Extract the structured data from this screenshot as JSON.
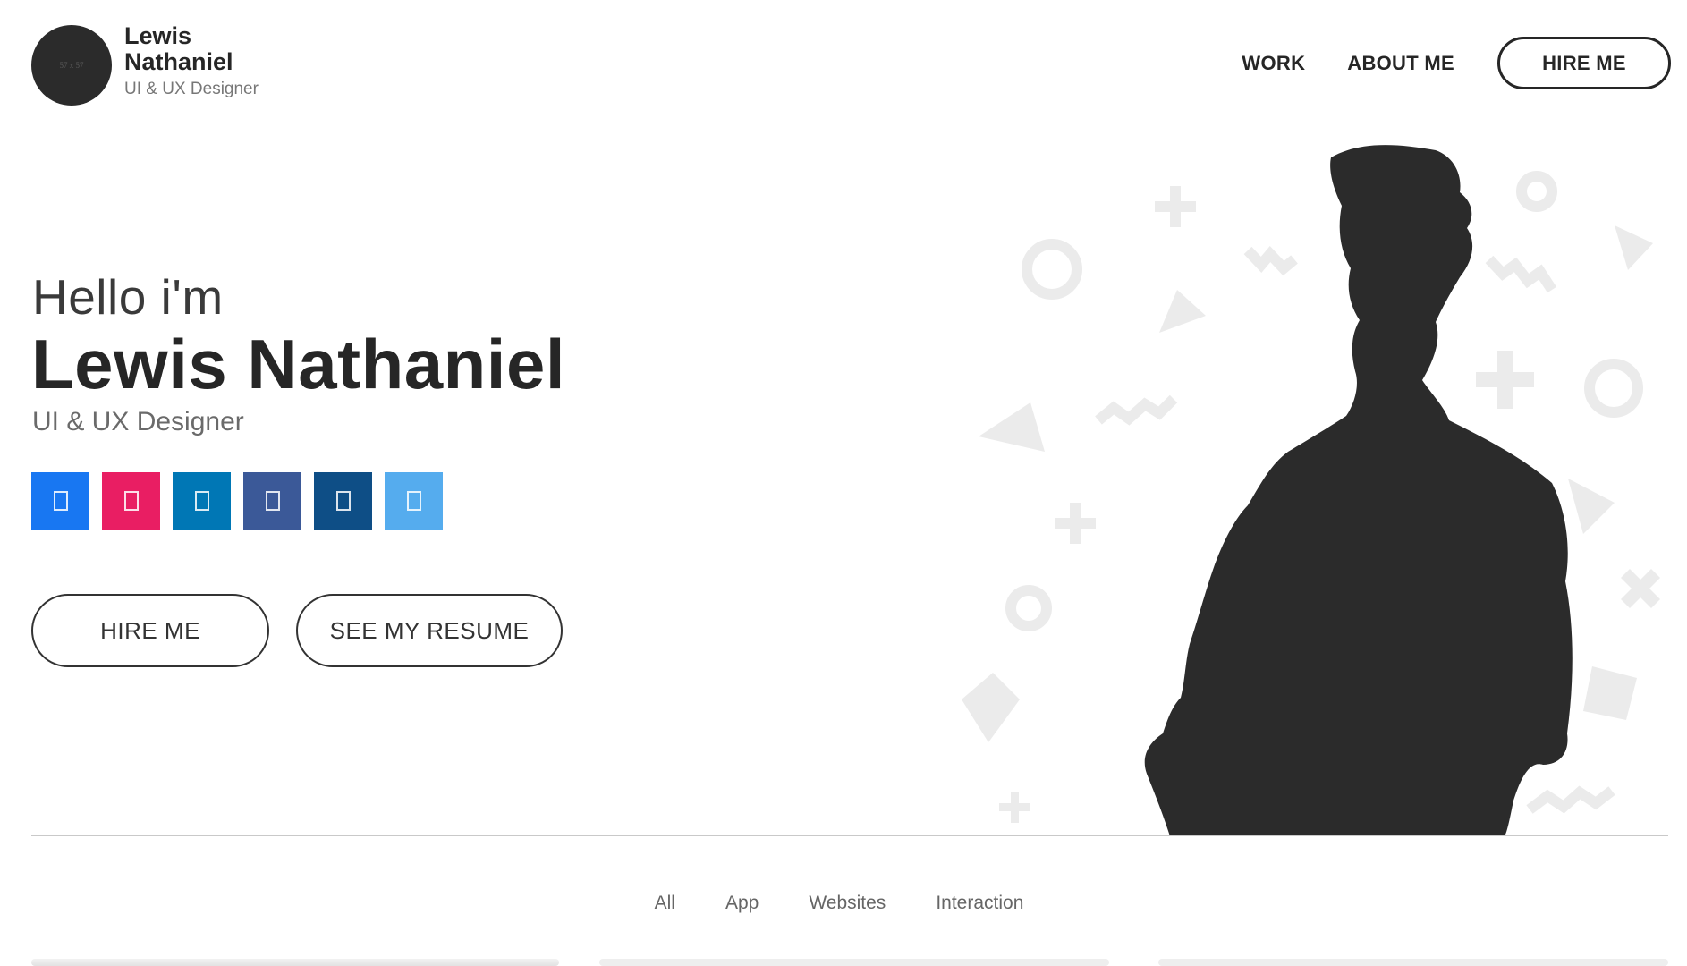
{
  "header": {
    "avatar_placeholder": "57 x 57",
    "brand_name": "Lewis Nathaniel",
    "brand_role": "UI & UX Designer",
    "nav": [
      {
        "label": "WORK"
      },
      {
        "label": "ABOUT ME"
      }
    ],
    "hire_label": "HIRE ME"
  },
  "hero": {
    "greeting": "Hello i'm",
    "name": "Lewis Nathaniel",
    "role": "UI & UX Designer",
    "socials": [
      {
        "icon": "facebook-icon",
        "color": "#1877f2"
      },
      {
        "icon": "instagram-icon",
        "color": "#e91e63"
      },
      {
        "icon": "linkedin-icon",
        "color": "#0077b5"
      },
      {
        "icon": "facebook-alt-icon",
        "color": "#3b5998"
      },
      {
        "icon": "linkedin-alt-icon",
        "color": "#0e4e86"
      },
      {
        "icon": "twitter-icon",
        "color": "#55acee"
      }
    ],
    "hire_button": "HIRE ME",
    "resume_button": "SEE MY RESUME"
  },
  "filters": [
    {
      "label": "All"
    },
    {
      "label": "App"
    },
    {
      "label": "Websites"
    },
    {
      "label": "Interaction"
    }
  ],
  "colors": {
    "text_dark": "#262626",
    "silhouette": "#2b2b2b",
    "shapes": "#ebebeb"
  }
}
